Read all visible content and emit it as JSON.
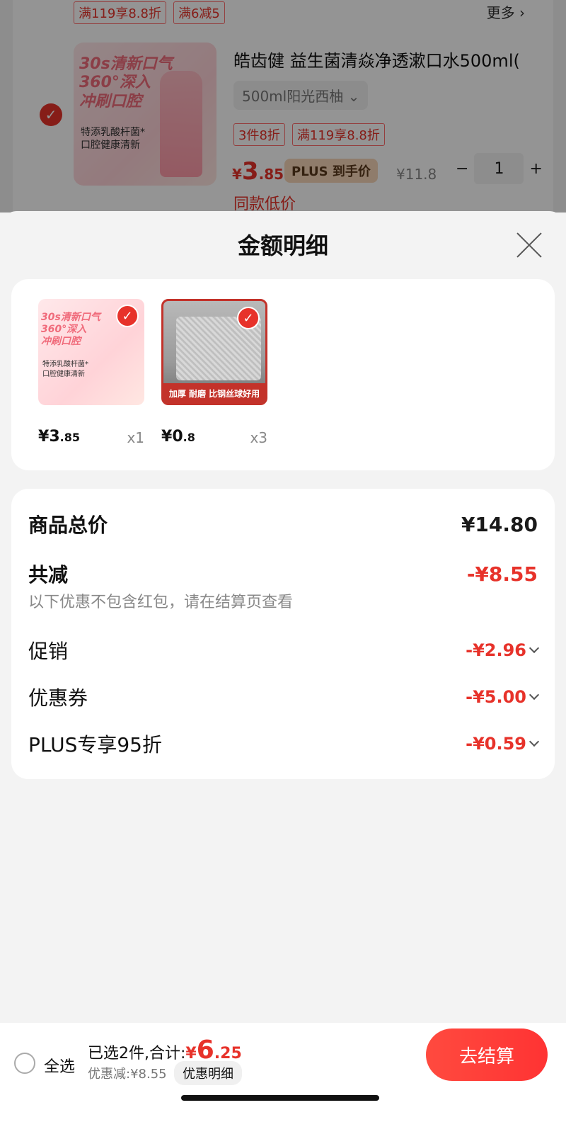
{
  "background_cart": {
    "top_tags": [
      "满119享8.8折",
      "满6减5"
    ],
    "more_label": "更多 ›",
    "check_icon": "✓",
    "product_title": "皓齿健 益生菌清焱净透漱口水500ml(",
    "spec": "500ml阳光西柚 ⌄",
    "tags": [
      "3件8折",
      "满119享8.8折"
    ],
    "price_symbol": "¥",
    "price_int": "3",
    "price_dec": ".85",
    "plus_badge": "PLUS 到手价",
    "original_price": "¥11.8",
    "minus": "−",
    "qty": "1",
    "plus": "+",
    "low_price": "同款低价",
    "art_title": "30s清新口气\n360°深入\n冲刷口腔",
    "art_sub": "特添乳酸杆菌*\n口腔健康清新"
  },
  "sheet": {
    "title": "金额明细",
    "items": [
      {
        "price_symbol": "¥",
        "price_int": "3",
        "price_dec": ".85",
        "qty": "x1",
        "check": "✓",
        "art_title": "30s清新口气\n360°深入\n冲刷口腔",
        "art_sub": "特添乳酸杆菌*\n口腔健康清新"
      },
      {
        "price_symbol": "¥",
        "price_int": "0",
        "price_dec": ".8",
        "qty": "x3",
        "check": "✓",
        "band": "加厚  耐磨 比钢丝球好用"
      }
    ],
    "details": {
      "total_label": "商品总价",
      "total_value": "¥14.80",
      "reduce_label": "共减",
      "reduce_value": "-¥8.55",
      "note": "以下优惠不包含红包，请在结算页查看",
      "lines": [
        {
          "label": "促销",
          "value": "-¥2.96"
        },
        {
          "label": "优惠券",
          "value": "-¥5.00"
        },
        {
          "label": "PLUS专享95折",
          "value": "-¥0.59"
        }
      ]
    }
  },
  "bottom_bar": {
    "select_all": "全选",
    "selected_prefix": "已选2件,合计:",
    "total_symbol": "¥",
    "total_int": "6",
    "total_dec": ".25",
    "discount": "优惠减:¥8.55",
    "detail_chip": "优惠明细",
    "checkout": "去结算"
  },
  "colors": {
    "accent": "#e7322a",
    "overlay": "rgba(0,0,0,0.42)"
  }
}
